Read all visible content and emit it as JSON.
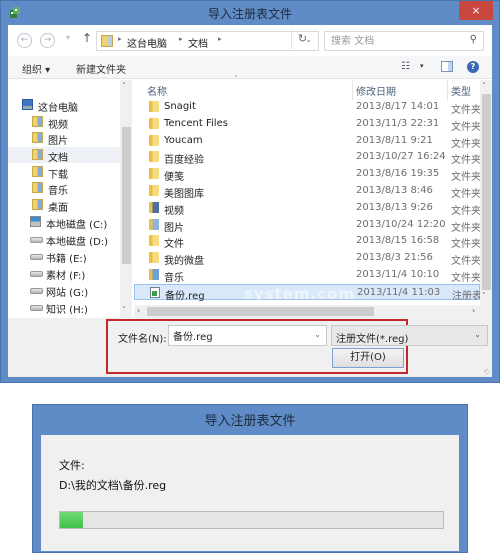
{
  "open_dialog": {
    "title": "导入注册表文件",
    "close_icon": "×",
    "nav": {
      "back_icon": "←",
      "forward_icon": "→",
      "recent_icon": "▾",
      "up_icon": "↑",
      "breadcrumb": [
        "这台电脑",
        "文档"
      ],
      "breadcrumb_sep": "▸",
      "dropdown_icon": "⌄",
      "refresh_icon": "↻",
      "search_placeholder": "搜索 文档",
      "search_icon": "⚲"
    },
    "toolbar": {
      "organize_label": "组织 ▾",
      "new_folder_label": "新建文件夹",
      "view_icon": "☷",
      "view_dropdown": "▾",
      "help_icon": "?"
    },
    "nav_pane": {
      "items": [
        {
          "label": "这台电脑",
          "icon": "computer"
        },
        {
          "label": "视频",
          "icon": "video-library"
        },
        {
          "label": "图片",
          "icon": "picture-library"
        },
        {
          "label": "文档",
          "icon": "document-library",
          "selected": true
        },
        {
          "label": "下载",
          "icon": "download-library"
        },
        {
          "label": "音乐",
          "icon": "music-library"
        },
        {
          "label": "桌面",
          "icon": "desktop-library"
        },
        {
          "label": "本地磁盘 (C:)",
          "icon": "system-drive"
        },
        {
          "label": "本地磁盘 (D:)",
          "icon": "drive"
        },
        {
          "label": "书籍 (E:)",
          "icon": "drive"
        },
        {
          "label": "素材 (F:)",
          "icon": "drive"
        },
        {
          "label": "网站 (G:)",
          "icon": "drive"
        },
        {
          "label": "知识 (H:)",
          "icon": "drive"
        }
      ],
      "scroll_up": "˄",
      "scroll_down": "˅"
    },
    "file_list": {
      "columns": [
        "名称",
        "修改日期",
        "类型"
      ],
      "sort_indicator": "˄",
      "rows": [
        {
          "name": "Snagit",
          "date": "2013/8/17 14:01",
          "type": "文件夹",
          "icon": "folder"
        },
        {
          "name": "Tencent Files",
          "date": "2013/11/3 22:31",
          "type": "文件夹",
          "icon": "folder"
        },
        {
          "name": "Youcam",
          "date": "2013/8/11 9:21",
          "type": "文件夹",
          "icon": "folder"
        },
        {
          "name": "百度经验",
          "date": "2013/10/27 16:24",
          "type": "文件夹",
          "icon": "folder"
        },
        {
          "name": "便笺",
          "date": "2013/8/16 19:35",
          "type": "文件夹",
          "icon": "folder"
        },
        {
          "name": "美图图库",
          "date": "2013/8/13 8:46",
          "type": "文件夹",
          "icon": "folder"
        },
        {
          "name": "视频",
          "date": "2013/8/13 9:26",
          "type": "文件夹",
          "icon": "video-folder"
        },
        {
          "name": "图片",
          "date": "2013/10/24 12:20",
          "type": "文件夹",
          "icon": "picture-folder"
        },
        {
          "name": "文件",
          "date": "2013/8/15 16:58",
          "type": "文件夹",
          "icon": "folder"
        },
        {
          "name": "我的微盘",
          "date": "2013/8/3 21:56",
          "type": "文件夹",
          "icon": "folder"
        },
        {
          "name": "音乐",
          "date": "2013/11/4 10:10",
          "type": "文件夹",
          "icon": "music-folder"
        },
        {
          "name": "备份.reg",
          "date": "2013/11/4 11:03",
          "type": "注册表项",
          "icon": "registry-file",
          "selected": true
        }
      ],
      "scroll_up": "˄",
      "scroll_down": "˅",
      "scroll_left": "‹",
      "scroll_right": "›",
      "watermark": "system.com"
    },
    "bottom": {
      "filename_label": "文件名(N):",
      "filename_value": "备份.reg",
      "filename_dropdown": "⌄",
      "filetype_value": "注册文件(*.reg)",
      "filetype_dropdown": "⌄",
      "open_button": "打开(O)"
    }
  },
  "progress_dialog": {
    "title": "导入注册表文件",
    "file_label": "文件:",
    "file_path": "D:\\我的文档\\备份.reg",
    "progress_percent": 6,
    "progress_color": "#4fcf5b"
  }
}
